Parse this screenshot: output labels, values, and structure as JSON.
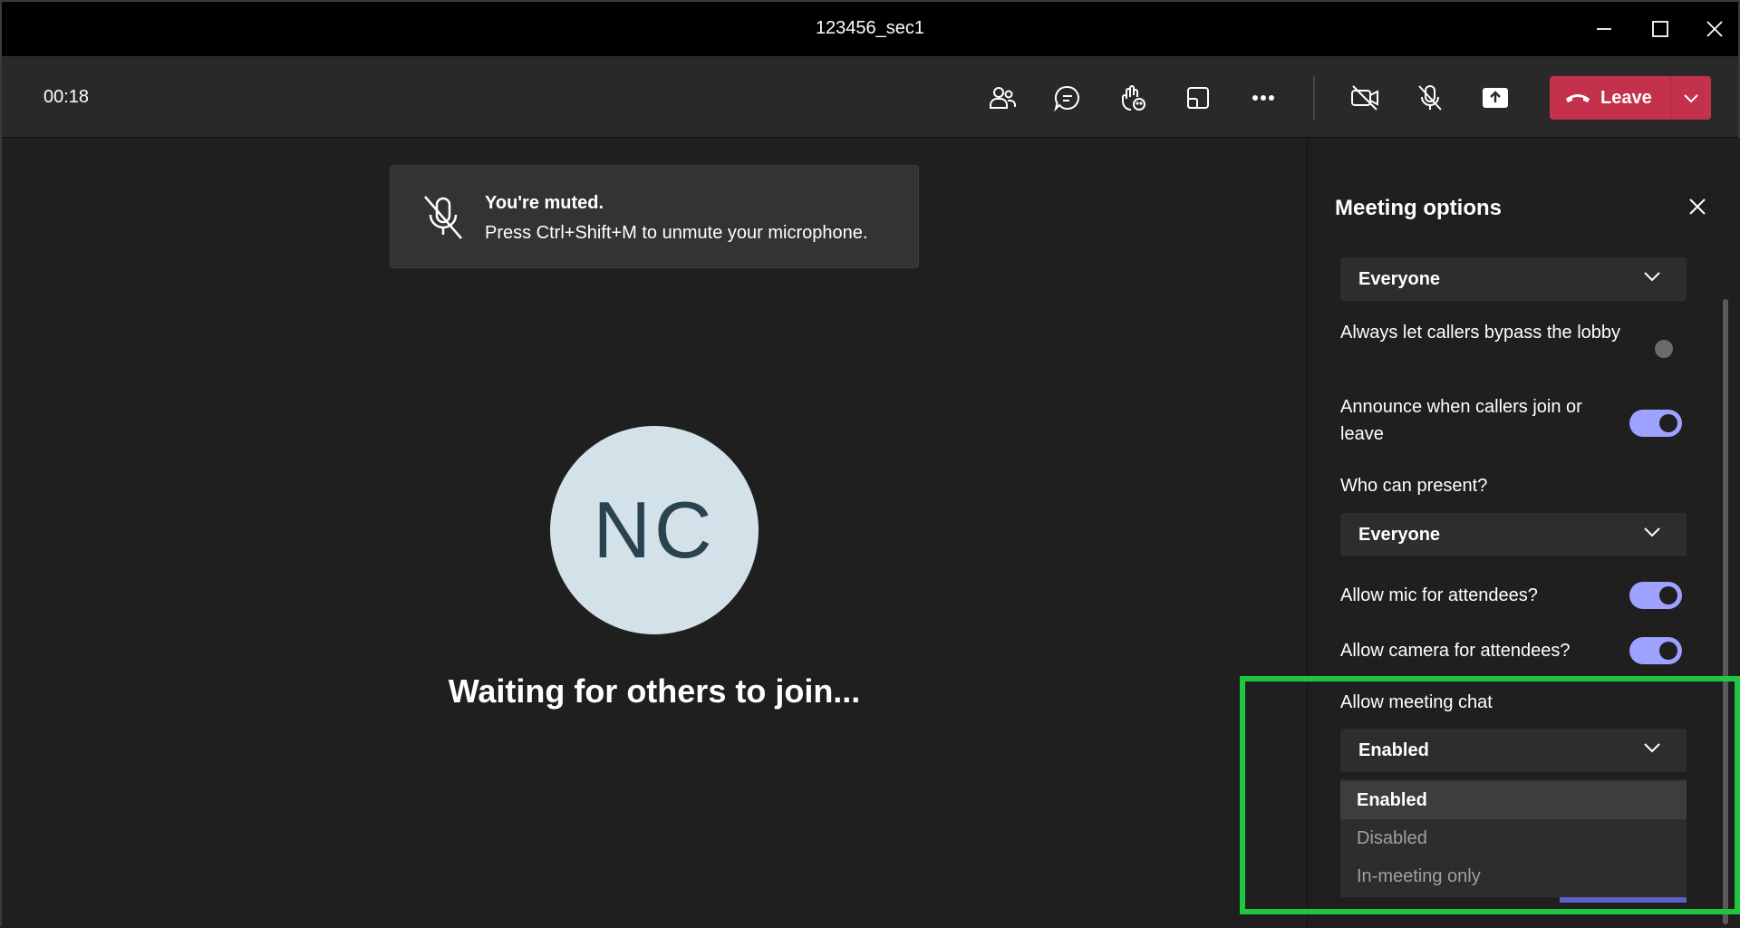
{
  "window": {
    "title": "123456_sec1"
  },
  "toolbar": {
    "timer": "00:18",
    "leave_label": "Leave"
  },
  "toast": {
    "title": "You're muted.",
    "message": "Press Ctrl+Shift+M to unmute your microphone."
  },
  "stage": {
    "avatar_initials": "NC",
    "status": "Waiting for others to join..."
  },
  "panel": {
    "title": "Meeting options",
    "lobby_value": "Everyone",
    "bypass_lobby_label": "Always let callers bypass the lobby",
    "bypass_lobby_on": false,
    "announce_label": "Announce when callers join or leave",
    "announce_on": true,
    "who_present_label": "Who can present?",
    "who_present_value": "Everyone",
    "mic_label": "Allow mic for attendees?",
    "mic_on": true,
    "camera_label": "Allow camera for attendees?",
    "camera_on": true,
    "chat_label": "Allow meeting chat",
    "chat_value": "Enabled",
    "chat_options": [
      "Enabled",
      "Disabled",
      "In-meeting only"
    ]
  },
  "colors": {
    "leave_red": "#c4314b",
    "toggle_on": "#9ea2ff",
    "highlight": "#1fc63f",
    "avatar_bg": "#d3e1e8"
  },
  "icons": [
    "minimize-icon",
    "maximize-icon",
    "close-icon",
    "people-icon",
    "chat-icon",
    "raise-hand-icon",
    "share-tray-icon",
    "more-icon",
    "camera-off-icon",
    "mic-off-icon",
    "share-screen-icon",
    "phone-hangup-icon",
    "chevron-down-icon"
  ]
}
